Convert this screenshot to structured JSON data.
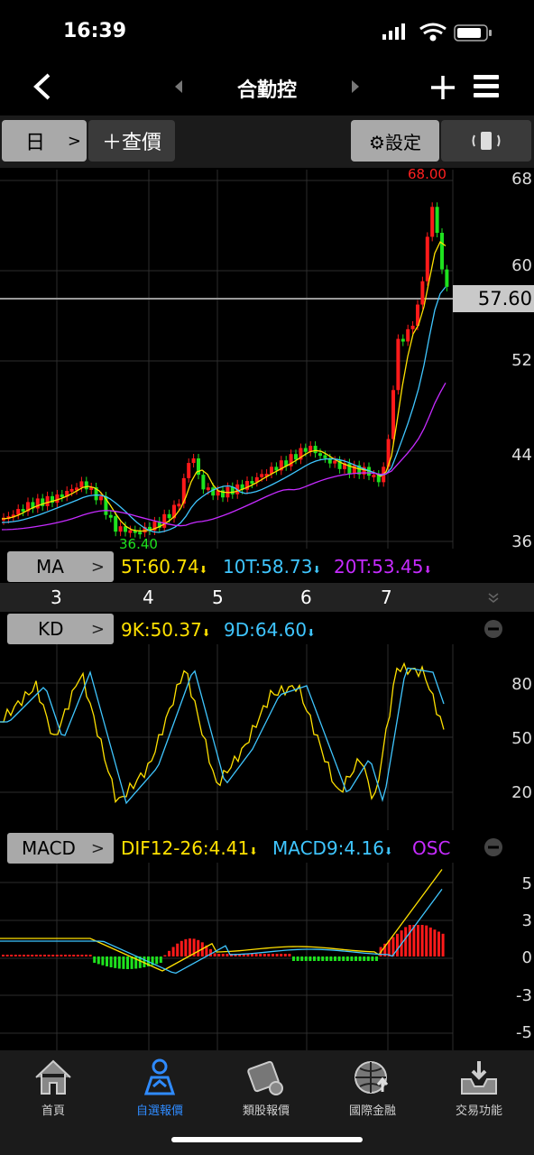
{
  "status_bar": {
    "time": "16:39"
  },
  "nav": {
    "title": "合勤控"
  },
  "toolbar": {
    "period": "日",
    "quote_label": "＋查價",
    "settings_label": "⚙設定"
  },
  "price_chart": {
    "high_label": "68.00",
    "low_label": "36.40",
    "current_price": "57.60",
    "y_ticks": [
      "68",
      "60",
      "52",
      "44",
      "36"
    ],
    "month_labels": [
      "3",
      "4",
      "5",
      "6",
      "7"
    ]
  },
  "ma": {
    "label": "MA",
    "ma5": "5T:60.74",
    "ma10": "10T:58.73",
    "ma20": "20T:53.45",
    "arrows": [
      "⬇",
      "⬇",
      "⬇"
    ]
  },
  "kd": {
    "label": "KD",
    "k": "9K:50.37",
    "d": "9D:64.60",
    "arrows": [
      "⬇",
      "⬇"
    ],
    "y_ticks": [
      "80",
      "50",
      "20"
    ]
  },
  "macd": {
    "label": "MACD",
    "dif": "DIF12-26:4.41",
    "macd9": "MACD9:4.16",
    "osc": "OSC",
    "arrows": [
      "⬇",
      "⬇"
    ],
    "y_ticks": [
      "5",
      "3",
      "0",
      "-3",
      "-5"
    ]
  },
  "tabs": [
    {
      "label": "首頁",
      "icon": "home-icon"
    },
    {
      "label": "自選報價",
      "icon": "watchlist-icon"
    },
    {
      "label": "類股報價",
      "icon": "sector-icon"
    },
    {
      "label": "國際金融",
      "icon": "globe-icon"
    },
    {
      "label": "交易功能",
      "icon": "trade-icon"
    }
  ],
  "colors": {
    "up": "#ff1a1a",
    "down": "#1ee21e",
    "ma5": "#ffe100",
    "ma10": "#3fc6ff",
    "ma20": "#c62bff",
    "active_tab": "#2f8bff"
  }
}
